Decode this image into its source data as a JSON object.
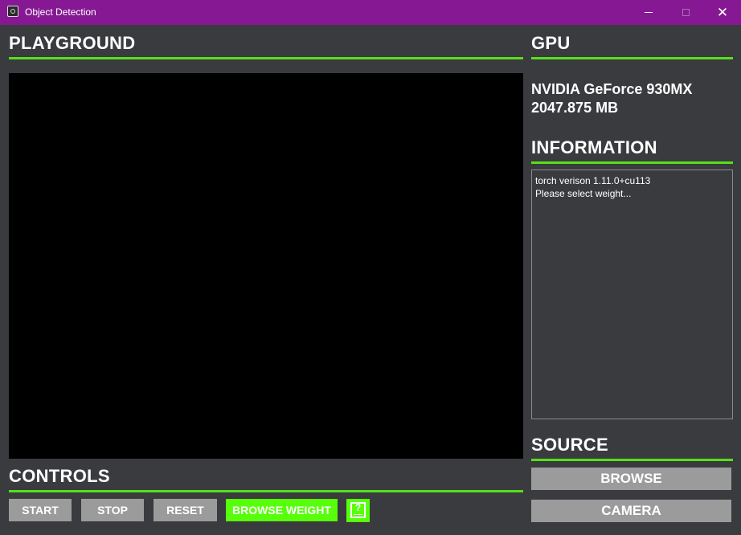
{
  "window": {
    "title": "Object Detection",
    "icon": "app-logo-icon",
    "controls": {
      "minimize": "—",
      "maximize": "□",
      "close": "✕"
    }
  },
  "playground": {
    "heading": "PLAYGROUND"
  },
  "controls": {
    "heading": "CONTROLS",
    "start_label": "START",
    "stop_label": "STOP",
    "reset_label": "RESET",
    "browse_weight_label": "BROWSE WEIGHT",
    "help_icon": "help-book-icon",
    "help_glyph": "?"
  },
  "gpu": {
    "heading": "GPU",
    "name": "NVIDIA GeForce 930MX",
    "memory": "2047.875 MB"
  },
  "information": {
    "heading": "INFORMATION",
    "lines": [
      "torch verison 1.11.0+cu113",
      "Please select weight..."
    ]
  },
  "source": {
    "heading": "SOURCE",
    "browse_label": "BROWSE",
    "camera_label": "CAMERA"
  },
  "colors": {
    "titlebar": "#861893",
    "background": "#3a3b3e",
    "accent_green": "#57ff0b",
    "rule_green": "#55e01a",
    "button_gray": "#9b9b9b"
  }
}
